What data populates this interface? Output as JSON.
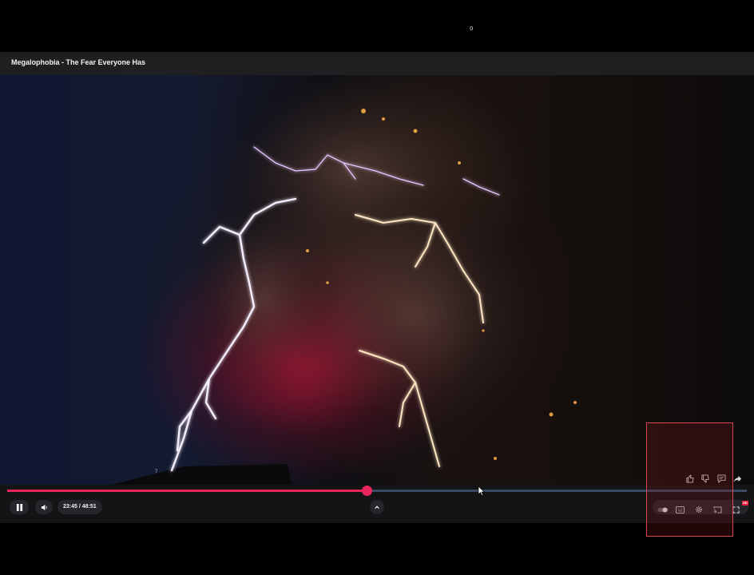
{
  "top_counter": "0",
  "video": {
    "title": "Megalophobia - The Fear Everyone Has",
    "frame_mark": "7"
  },
  "player": {
    "current_time": "23:45",
    "separator": " / ",
    "duration": "48:51",
    "progress_fraction": 0.486,
    "accent_color": "#e8265d",
    "track_color": "#3a4a63",
    "hd_badge": "HD"
  },
  "icons": {
    "play_pause": "pause-icon",
    "volume": "volume-icon",
    "expand": "chevron-up-icon",
    "autoplay": "autoplay-toggle-icon",
    "captions": "captions-icon",
    "settings": "gear-icon",
    "cast": "cast-icon",
    "fullscreen": "fullscreen-icon",
    "like": "thumbs-up-icon",
    "dislike": "thumbs-down-icon",
    "comment": "comment-icon",
    "share": "share-icon"
  }
}
